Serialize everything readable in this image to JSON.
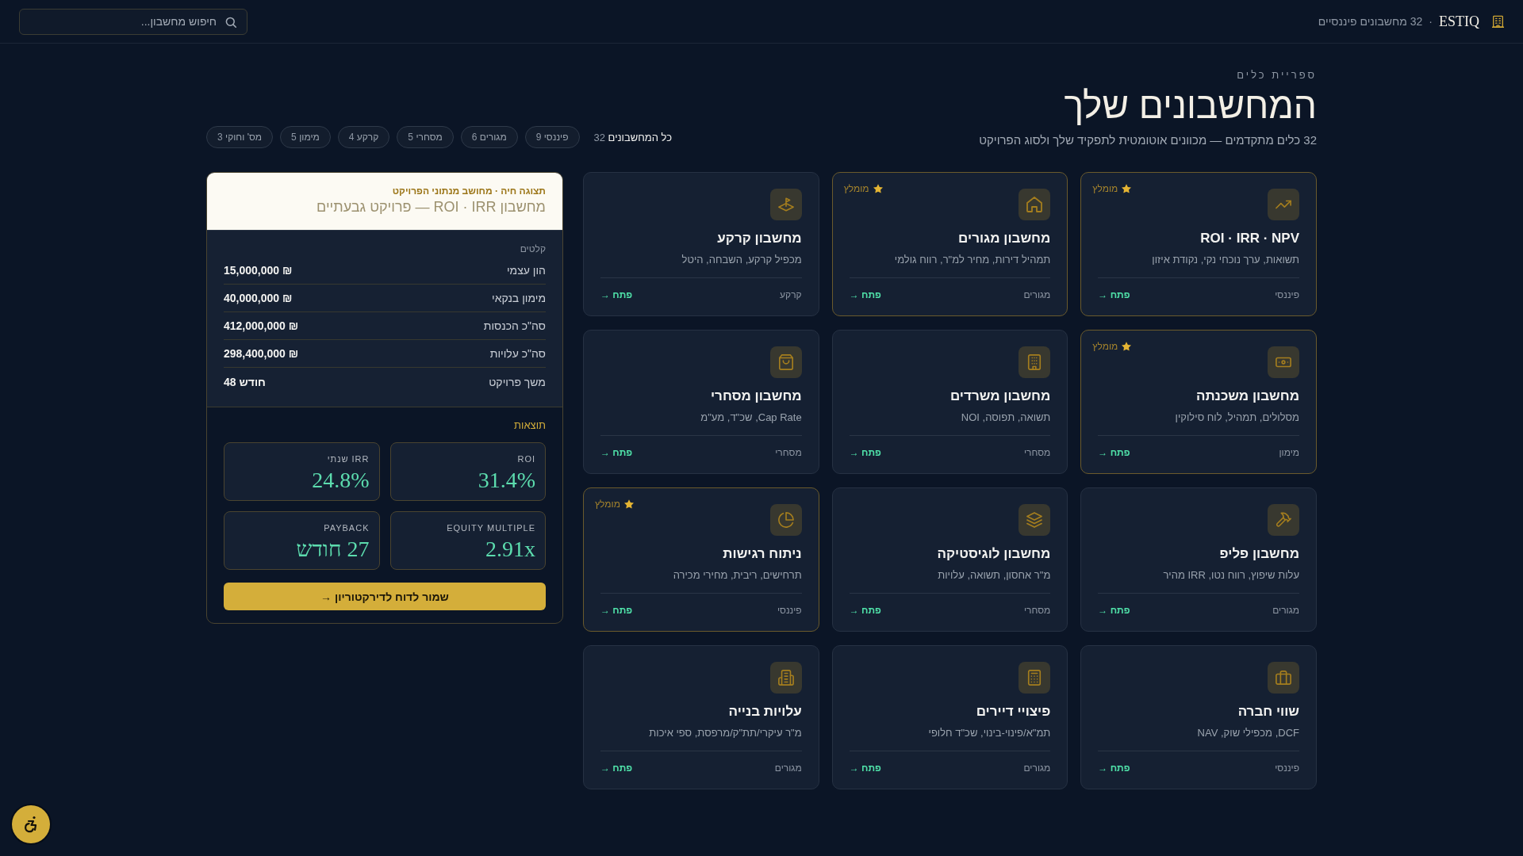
{
  "topbar": {
    "brand": {
      "name": "ESTIQ",
      "separator": "·",
      "tagline": "32 מחשבונים פיננסיים"
    },
    "search": {
      "placeholder": "חיפוש מחשבון..."
    }
  },
  "header": {
    "eyebrow": "ספריית כלים",
    "title": "המחשבונים שלך",
    "subtitle": "32 כלים מתקדמים — מכוונים אוטומטית לתפקיד שלך ולסוג הפרויקט"
  },
  "filters": [
    {
      "label": "כל המחשבונים",
      "count": "32",
      "selected": true
    },
    {
      "label": "פיננסי",
      "count": "9",
      "selected": false
    },
    {
      "label": "מגורים",
      "count": "6",
      "selected": false
    },
    {
      "label": "מסחרי",
      "count": "5",
      "selected": false
    },
    {
      "label": "קרקע",
      "count": "4",
      "selected": false
    },
    {
      "label": "מימון",
      "count": "5",
      "selected": false
    },
    {
      "label": "מס' וחוקי",
      "count": "3",
      "selected": false
    }
  ],
  "cards": [
    {
      "title": "ROI · IRR · NPV",
      "description": "תשואות, ערך נוכחי נקי, נקודת איזון",
      "category": "פיננסי",
      "action": "פתח →",
      "featured": true,
      "badge": "מומלץ"
    },
    {
      "title": "מחשבון מגורים",
      "description": "תמהיל דירות, מחיר למ\"ר, רווח גולמי",
      "category": "מגורים",
      "action": "פתח →",
      "featured": true,
      "badge": "מומלץ"
    },
    {
      "title": "מחשבון קרקע",
      "description": "מכפיל קרקע, השבחה, היטל",
      "category": "קרקע",
      "action": "פתח →",
      "featured": false
    },
    {
      "title": "מחשבון משכנתה",
      "description": "מסלולים, תמהיל, לוח סילוקין",
      "category": "מימון",
      "action": "פתח →",
      "featured": true,
      "badge": "מומלץ"
    },
    {
      "title": "מחשבון משרדים",
      "description": "תשואה, תפוסה, NOI",
      "category": "מסחרי",
      "action": "פתח →",
      "featured": false
    },
    {
      "title": "מחשבון מסחרי",
      "description": "Cap Rate, שכ\"ד, מע\"מ",
      "category": "מסחרי",
      "action": "פתח →",
      "featured": false
    },
    {
      "title": "מחשבון פליפ",
      "description": "עלות שיפוץ, רווח נטו, IRR מהיר",
      "category": "מגורים",
      "action": "פתח →",
      "featured": false
    },
    {
      "title": "מחשבון לוגיסטיקה",
      "description": "מ\"ר אחסון, תשואה, עלויות",
      "category": "מסחרי",
      "action": "פתח →",
      "featured": false
    },
    {
      "title": "ניתוח רגישות",
      "description": "תרחישים, ריבית, מחירי מכירה",
      "category": "פיננסי",
      "action": "פתח →",
      "featured": true,
      "badge": "מומלץ"
    },
    {
      "title": "שווי חברה",
      "description": "DCF, מכפילי שוק, NAV",
      "category": "פיננסי",
      "action": "פתח →",
      "featured": false
    },
    {
      "title": "פיצויי דיירים",
      "description": "תמ\"א/פינוי-בינוי, שכ\"ד חלופי",
      "category": "מגורים",
      "action": "פתח →",
      "featured": false
    },
    {
      "title": "עלויות בנייה",
      "description": "מ\"ר עיקרי/תת\"ק/מרפסת, ספי איכות",
      "category": "מגורים",
      "action": "פתח →",
      "featured": false
    }
  ],
  "preview": {
    "caption": "תצוגה חיה · מחושב מנתוני הפרויקט",
    "title": "מחשבון ROI · IRR — פרויקט גבעתיים",
    "inputs": {
      "heading": "קלטים",
      "rows": [
        {
          "label": "הון עצמי",
          "value": "15,000,000 ₪"
        },
        {
          "label": "מימון בנקאי",
          "value": "40,000,000 ₪"
        },
        {
          "label": "סה\"כ הכנסות",
          "value": "412,000,000 ₪"
        },
        {
          "label": "סה\"כ עלויות",
          "value": "298,400,000 ₪"
        },
        {
          "label": "משך פרויקט",
          "value": "48 חודש"
        }
      ]
    },
    "results": {
      "heading": "תוצאות",
      "metrics": [
        {
          "label": "ROI",
          "value": "31.4%"
        },
        {
          "label": "IRR שנתי",
          "value": "24.8%"
        },
        {
          "label": "EQUITY MULTIPLE",
          "value": "2.91x"
        },
        {
          "label": "PAYBACK",
          "value": "27 חודש"
        }
      ]
    },
    "button": "שמור לדוח לדירקטוריון →"
  }
}
